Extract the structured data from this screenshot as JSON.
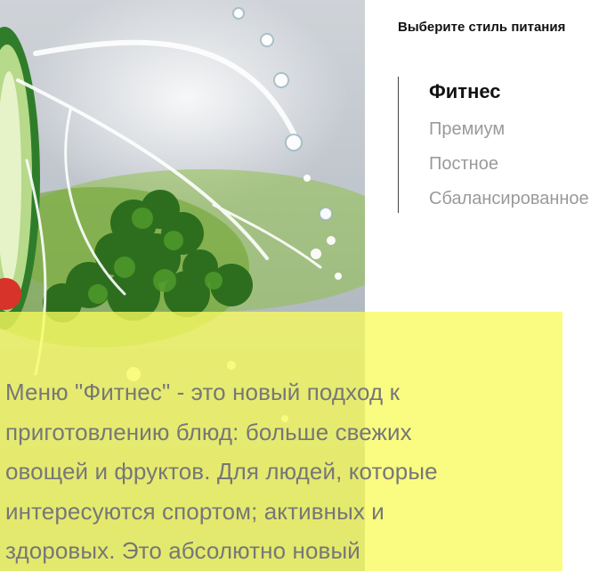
{
  "hero": {
    "icon": "fresh-vegetables-water-splash-image"
  },
  "menu": {
    "title": "Выберите стиль питания",
    "items": [
      {
        "label": "Фитнес",
        "active": true
      },
      {
        "label": "Премиум",
        "active": false
      },
      {
        "label": "Постное",
        "active": false
      },
      {
        "label": "Сбалансированное",
        "active": false
      }
    ]
  },
  "description": {
    "lines": [
      "Меню \"Фитнес\" - это новый подход к",
      "приготовлению блюд: больше свежих",
      "овощей и фруктов. Для людей, которые",
      "интересуются спортом; активных и",
      "здоровых. Это абсолютно новый"
    ]
  },
  "colors": {
    "panel": "#f7fb5c",
    "active_text": "#111111",
    "inactive_text": "#9a9a9a"
  }
}
